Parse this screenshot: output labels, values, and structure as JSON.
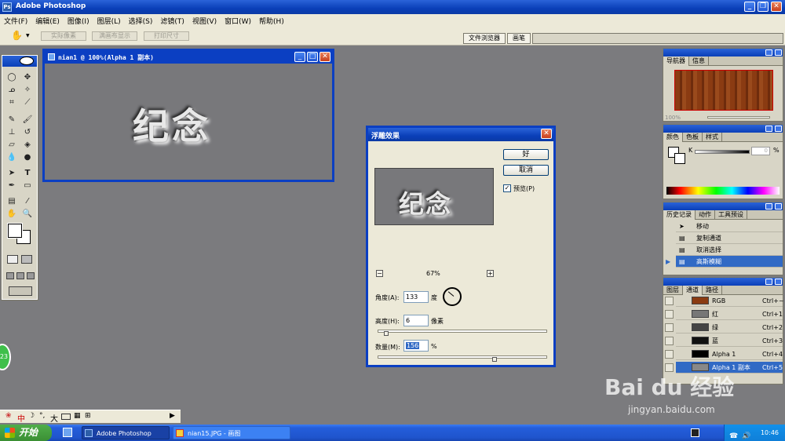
{
  "app": {
    "title": "Adobe Photoshop"
  },
  "menu": [
    "文件(F)",
    "编辑(E)",
    "图像(I)",
    "图层(L)",
    "选择(S)",
    "滤镜(T)",
    "视图(V)",
    "窗口(W)",
    "帮助(H)"
  ],
  "options": {
    "actual_pixels": "实际像素",
    "fit_on_screen": "满画布显示",
    "print_size": "打印尺寸",
    "file_browser": "文件浏览器",
    "brushes": "画笔"
  },
  "document": {
    "title": "nian1 @ 100%(Alpha 1 副本)",
    "text": "纪念"
  },
  "dialog": {
    "title": "浮雕效果",
    "ok": "好",
    "cancel": "取消",
    "preview_label": "预览(P)",
    "preview_text": "纪念",
    "zoom": "67%",
    "angle_label": "角度(A):",
    "angle_value": "133",
    "angle_unit": "度",
    "height_label": "高度(H):",
    "height_value": "6",
    "height_unit": "像素",
    "amount_label": "数量(M):",
    "amount_value": "156",
    "amount_unit": "%"
  },
  "navigator": {
    "tabs": [
      "导航器",
      "信息"
    ],
    "zoom": "100%"
  },
  "color": {
    "tabs": [
      "颜色",
      "色板",
      "样式"
    ],
    "channel": "K",
    "value": "0",
    "unit": "%"
  },
  "history": {
    "tabs": [
      "历史记录",
      "动作",
      "工具预设"
    ],
    "items": [
      "移动",
      "复制通道",
      "取消选择",
      "高斯模糊"
    ]
  },
  "channels": {
    "tabs": [
      "图层",
      "通道",
      "路径"
    ],
    "items": [
      {
        "name": "RGB",
        "shortcut": "Ctrl+~"
      },
      {
        "name": "红",
        "shortcut": "Ctrl+1"
      },
      {
        "name": "绿",
        "shortcut": "Ctrl+2"
      },
      {
        "name": "蓝",
        "shortcut": "Ctrl+3"
      },
      {
        "name": "Alpha 1",
        "shortcut": "Ctrl+4"
      },
      {
        "name": "Alpha 1 副本",
        "shortcut": "Ctrl+5"
      }
    ]
  },
  "taskbar": {
    "start": "开始",
    "tasks": [
      "Adobe Photoshop",
      "nian15.JPG - 画图"
    ],
    "time": "10:46"
  },
  "ime": {
    "lang": "中",
    "size": "大"
  },
  "badge": "23",
  "watermark": {
    "brand": "Bai du 经验",
    "url": "jingyan.baidu.com"
  }
}
